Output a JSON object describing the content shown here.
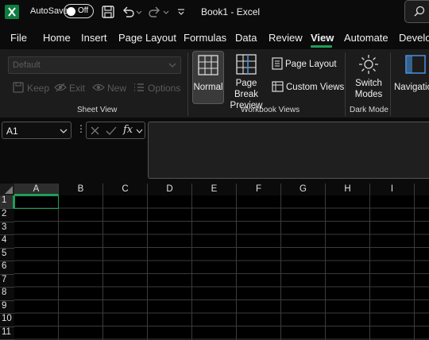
{
  "titlebar": {
    "autosave_label": "AutoSave",
    "autosave_state": "Off",
    "document_title": "Book1  -  Excel",
    "accent": "#1e9e5a"
  },
  "tabs": [
    "File",
    "Home",
    "Insert",
    "Page Layout",
    "Formulas",
    "Data",
    "Review",
    "View",
    "Automate",
    "Develop"
  ],
  "active_tab": "View",
  "ribbon": {
    "sheet_view": {
      "select_value": "Default",
      "buttons": [
        "Keep",
        "Exit",
        "New",
        "Options"
      ],
      "group_label": "Sheet View"
    },
    "workbook_views": {
      "normal": "Normal",
      "page_break_line1": "Page Break",
      "page_break_line2": "Preview",
      "page_layout": "Page Layout",
      "custom_views": "Custom Views",
      "group_label": "Workbook Views"
    },
    "dark_mode": {
      "switch_line1": "Switch",
      "switch_line2": "Modes",
      "group_label": "Dark Mode"
    },
    "navigation": "Navigation"
  },
  "formula_bar": {
    "name_box": "A1",
    "fx": "fx",
    "content": ""
  },
  "grid": {
    "columns": [
      "A",
      "B",
      "C",
      "D",
      "E",
      "F",
      "G",
      "H",
      "I"
    ],
    "rows": [
      "1",
      "2",
      "3",
      "4",
      "5",
      "6",
      "7",
      "8",
      "9",
      "10",
      "11"
    ],
    "active_cell": "A1"
  }
}
